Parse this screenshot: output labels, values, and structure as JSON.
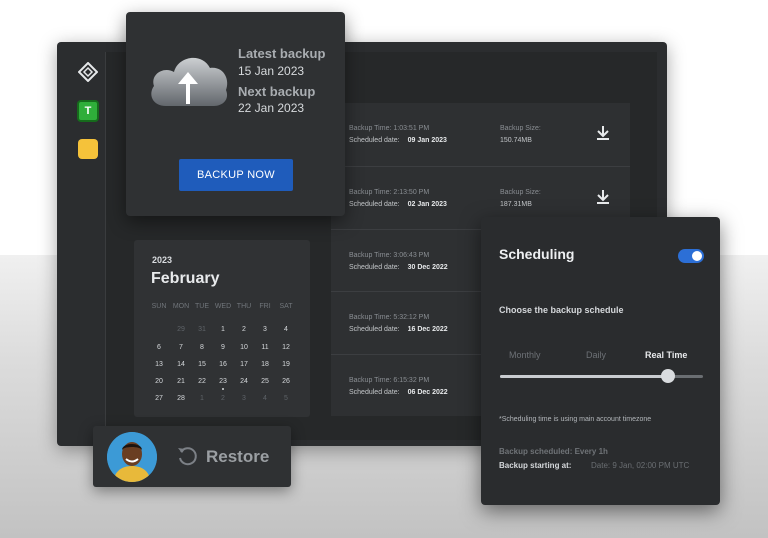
{
  "workspace": {
    "t_label": "T"
  },
  "backup_card": {
    "latest_label": "Latest backup",
    "latest_date": "15 Jan 2023",
    "next_label": "Next backup",
    "next_date": "22 Jan 2023",
    "button_label": "BACKUP NOW"
  },
  "backups": [
    {
      "time_label": "Backup Time: 1:03:51 PM",
      "sched_label": "Scheduled date:",
      "date": "09 Jan 2023",
      "size_label": "Backup Size:",
      "size": "150.74MB",
      "download": true
    },
    {
      "time_label": "Backup Time: 2:13:50 PM",
      "sched_label": "Scheduled date:",
      "date": "02 Jan 2023",
      "size_label": "Backup Size:",
      "size": "187.31MB",
      "download": true
    },
    {
      "time_label": "Backup Time: 3:06:43 PM",
      "sched_label": "Scheduled date:",
      "date": "30 Dec 2022",
      "size_label": "",
      "size": "",
      "download": false
    },
    {
      "time_label": "Backup Time: 5:32:12 PM",
      "sched_label": "Scheduled date:",
      "date": "16 Dec 2022",
      "size_label": "",
      "size": "",
      "download": false
    },
    {
      "time_label": "Backup Time: 6:15:32 PM",
      "sched_label": "Scheduled date:",
      "date": "06 Dec 2022",
      "size_label": "",
      "size": "",
      "download": false
    }
  ],
  "calendar": {
    "year": "2023",
    "month": "February",
    "weekdays": [
      "SUN",
      "MON",
      "TUE",
      "WED",
      "THU",
      "FRI",
      "SAT"
    ],
    "weeks": [
      [
        {
          "d": "29",
          "m": "prev"
        },
        {
          "d": "31",
          "m": "prev"
        },
        {
          "d": "1"
        },
        {
          "d": "2"
        },
        {
          "d": "3"
        },
        {
          "d": "4"
        }
      ],
      [
        {
          "d": "6"
        },
        {
          "d": "7"
        },
        {
          "d": "8"
        },
        {
          "d": "9"
        },
        {
          "d": "10"
        },
        {
          "d": "11"
        },
        {
          "d": "12"
        }
      ],
      [
        {
          "d": "13"
        },
        {
          "d": "14"
        },
        {
          "d": "15"
        },
        {
          "d": "16"
        },
        {
          "d": "17"
        },
        {
          "d": "18"
        },
        {
          "d": "19"
        }
      ],
      [
        {
          "d": "20"
        },
        {
          "d": "21"
        },
        {
          "d": "22"
        },
        {
          "d": "23",
          "marked": true
        },
        {
          "d": "24"
        },
        {
          "d": "25"
        },
        {
          "d": "26"
        }
      ],
      [
        {
          "d": "27"
        },
        {
          "d": "28"
        },
        {
          "d": "1",
          "m": "next"
        },
        {
          "d": "2",
          "m": "next"
        },
        {
          "d": "3",
          "m": "next"
        },
        {
          "d": "4",
          "m": "next"
        },
        {
          "d": "5",
          "m": "next"
        }
      ]
    ]
  },
  "restore": {
    "label": "Restore"
  },
  "scheduling": {
    "title": "Scheduling",
    "toggle_on": true,
    "subtitle": "Choose the backup schedule",
    "options": [
      "Monthly",
      "Daily",
      "Real Time"
    ],
    "selected": "Real Time",
    "slider_level": 0.83,
    "note": "*Scheduling time is using main account timezone",
    "backup_scheduled": "Backup scheduled: Every 1h",
    "backup_starting_label": "Backup starting at:",
    "backup_starting_value": "Date: 9 Jan, 02:00 PM UTC"
  },
  "colors": {
    "primary_button": "#1f5cbb",
    "toggle": "#2c6fd6",
    "workspace_green": "#2fae3a",
    "workspace_yellow": "#f5c23a"
  }
}
